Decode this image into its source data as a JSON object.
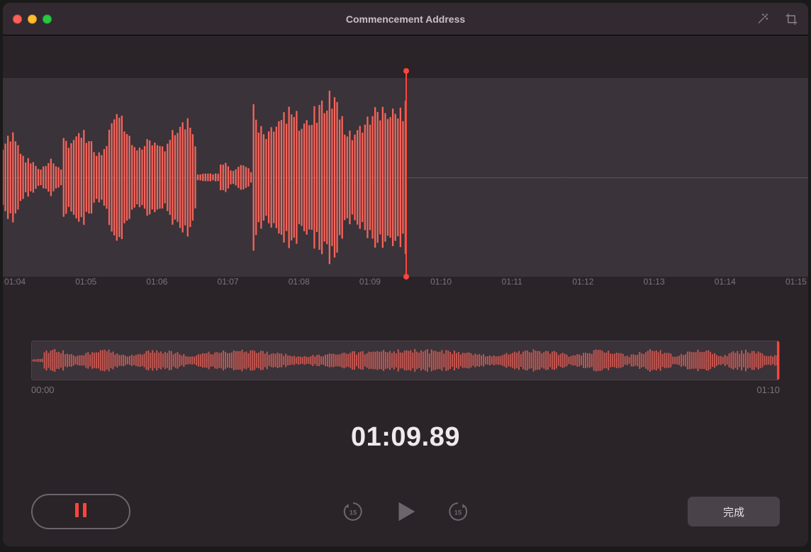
{
  "window": {
    "title": "Commencement Address"
  },
  "ruler": {
    "ticks": [
      "01:04",
      "01:05",
      "01:06",
      "01:07",
      "01:08",
      "01:09",
      "01:10",
      "01:11",
      "01:12",
      "01:13",
      "01:14",
      "01:15"
    ]
  },
  "overview": {
    "start_label": "00:00",
    "end_label": "01:10"
  },
  "playback": {
    "current_time": "01:09.89"
  },
  "transport": {
    "skip_back_label": "15",
    "skip_forward_label": "15"
  },
  "buttons": {
    "done": "完成"
  },
  "colors": {
    "accent": "#ff453a",
    "waveform": "#f6645a",
    "waveform_dim": "#c95751"
  }
}
